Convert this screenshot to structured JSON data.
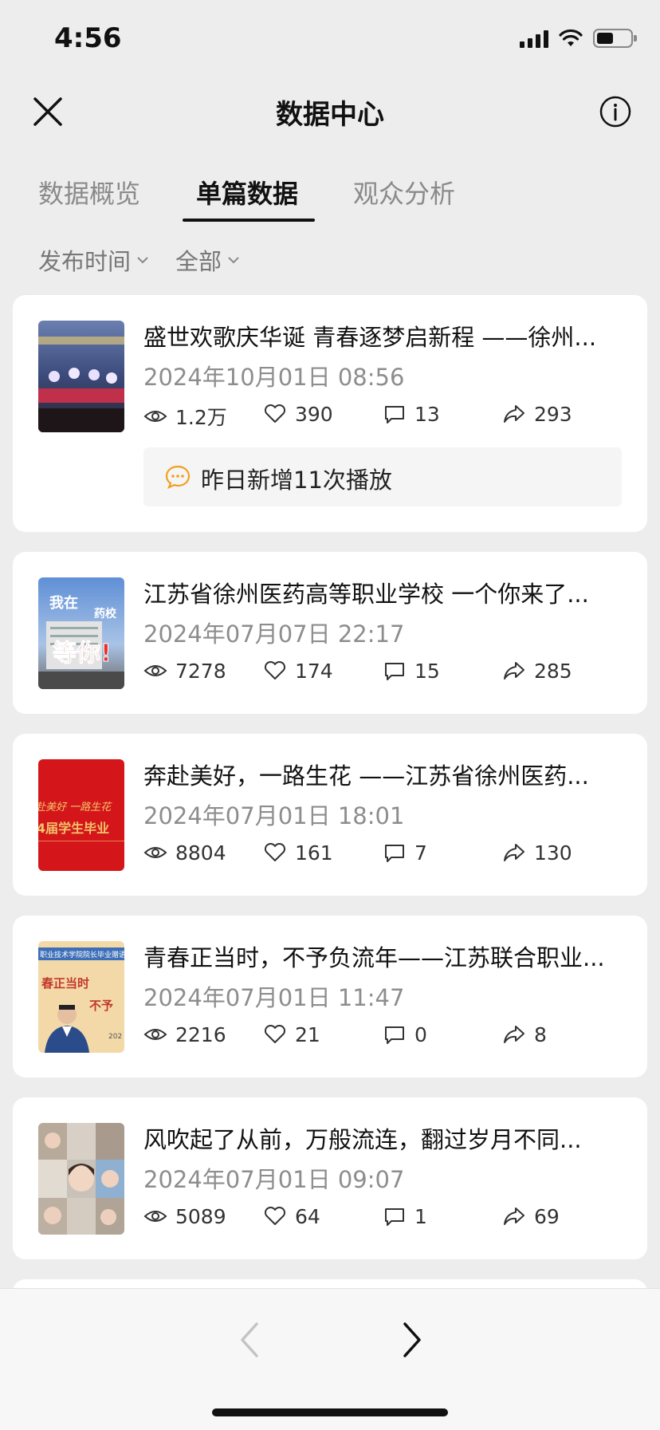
{
  "status_bar": {
    "time": "4:56",
    "battery_level": 0.5
  },
  "header": {
    "title": "数据中心",
    "close_icon": "close-icon",
    "info_icon": "info-icon"
  },
  "tabs": [
    {
      "label": "数据概览",
      "active": false
    },
    {
      "label": "单篇数据",
      "active": true
    },
    {
      "label": "观众分析",
      "active": false
    }
  ],
  "filters": [
    {
      "label": "发布时间"
    },
    {
      "label": "全部"
    }
  ],
  "articles": [
    {
      "title": "盛世欢歌庆华诞 青春逐梦启新程 ——徐州...",
      "date": "2024年10月01日 08:56",
      "views": "1.2万",
      "likes": "390",
      "comments": "13",
      "shares": "293",
      "notice": "昨日新增11次播放",
      "thumb_colors": [
        "#3b4a7a",
        "#c0304a"
      ]
    },
    {
      "title": "江苏省徐州医药高等职业学校 一个你来了...",
      "date": "2024年07月07日 22:17",
      "views": "7278",
      "likes": "174",
      "comments": "15",
      "shares": "285",
      "thumb_text": [
        "我在",
        "药校",
        "等你!"
      ],
      "thumb_colors": [
        "#4f7fc4",
        "#d8d8d8"
      ]
    },
    {
      "title": "奔赴美好，一路生花 ——江苏省徐州医药...",
      "date": "2024年07月01日 18:01",
      "views": "8804",
      "likes": "161",
      "comments": "7",
      "shares": "130",
      "thumb_text": [
        "赴美好 一路生花",
        "4届学生毕业"
      ],
      "thumb_colors": [
        "#d4161b",
        "#f0c56a"
      ]
    },
    {
      "title": "青春正当时，不予负流年——江苏联合职业...",
      "date": "2024年07月01日 11:47",
      "views": "2216",
      "likes": "21",
      "comments": "0",
      "shares": "8",
      "thumb_text": [
        "职业技术学院院长毕业赠语",
        "春正当时",
        "不予",
        "202"
      ],
      "thumb_colors": [
        "#f4d9a8",
        "#3c6fb8"
      ]
    },
    {
      "title": "风吹起了从前，万般流连，翻过岁月不同...",
      "date": "2024年07月01日 09:07",
      "views": "5089",
      "likes": "64",
      "comments": "1",
      "shares": "69",
      "thumb_colors": [
        "#c9c2b8",
        "#6a5a4e"
      ]
    }
  ],
  "pager": {
    "prev_icon": "chevron-left-icon",
    "next_icon": "chevron-right-icon",
    "prev_enabled": false,
    "next_enabled": true
  },
  "colors": {
    "background": "#ededed",
    "card": "#ffffff",
    "notice_icon": "#f0a020"
  }
}
